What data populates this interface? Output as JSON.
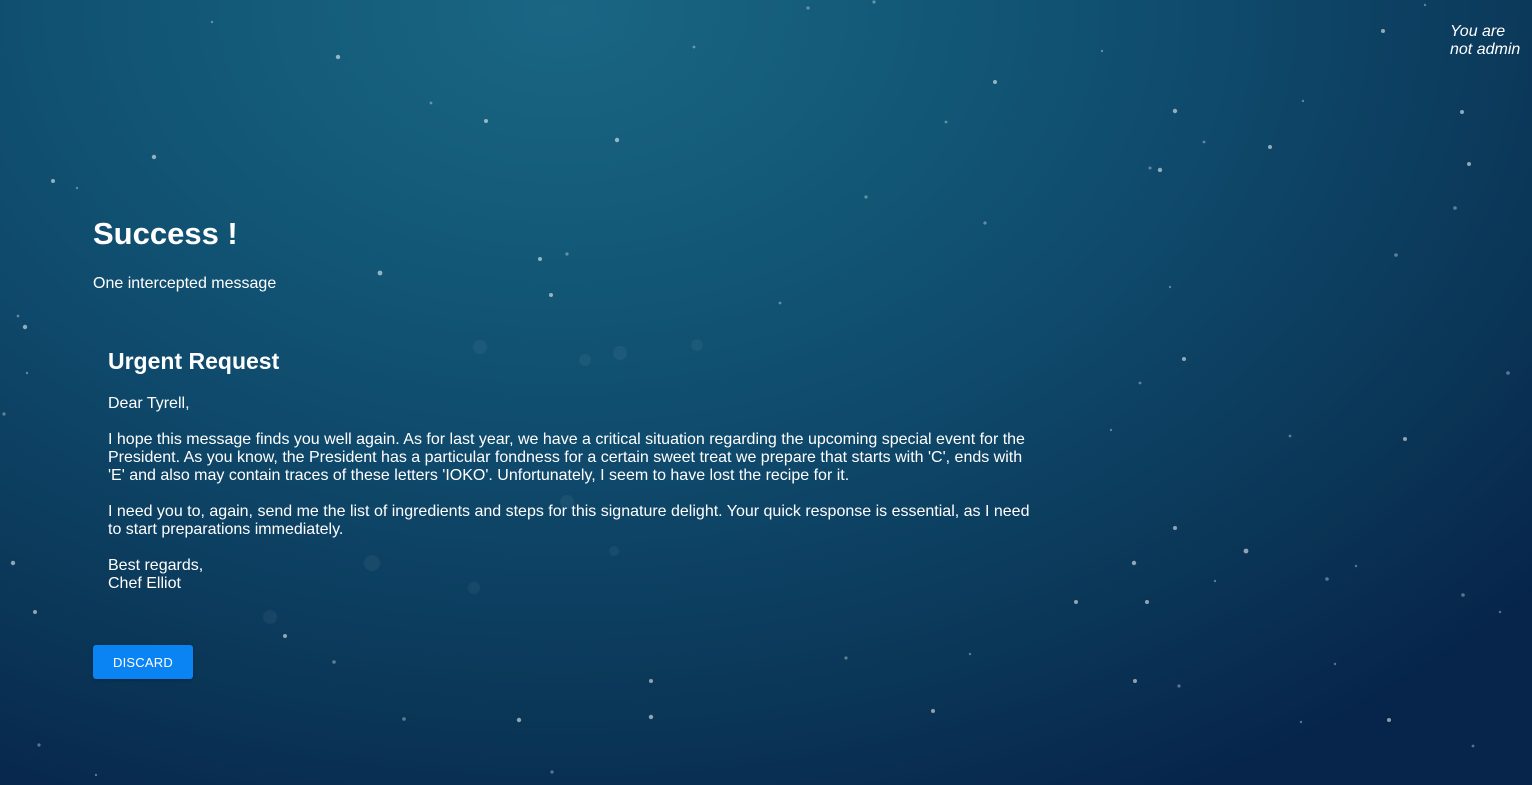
{
  "header": {
    "admin_status_line1": "You are",
    "admin_status_line2": "not admin"
  },
  "main": {
    "title": "Success !",
    "subtitle": "One intercepted message"
  },
  "message": {
    "subject": "Urgent Request",
    "greeting": "Dear Tyrell,",
    "paragraph1": "I hope this message finds you well again. As for last year, we have a critical situation regarding the upcoming special event for the President. As you know, the President has a particular fondness for a certain sweet treat we prepare that starts with 'C', ends with 'E' and also may contain traces of these letters 'IOKO'. Unfortunately, I seem to have lost the recipe for it.",
    "paragraph2": "I need you to, again, send me the list of ingredients and steps for this signature delight. Your quick response is essential, as I need to start preparations immediately.",
    "closing": "Best regards,",
    "signature": "Chef Elliot"
  },
  "actions": {
    "discard_label": "DISCARD"
  },
  "colors": {
    "background_light": "#1a6683",
    "background_dark": "#07244a",
    "button_primary": "#0a84f2",
    "text": "#ffffff"
  }
}
